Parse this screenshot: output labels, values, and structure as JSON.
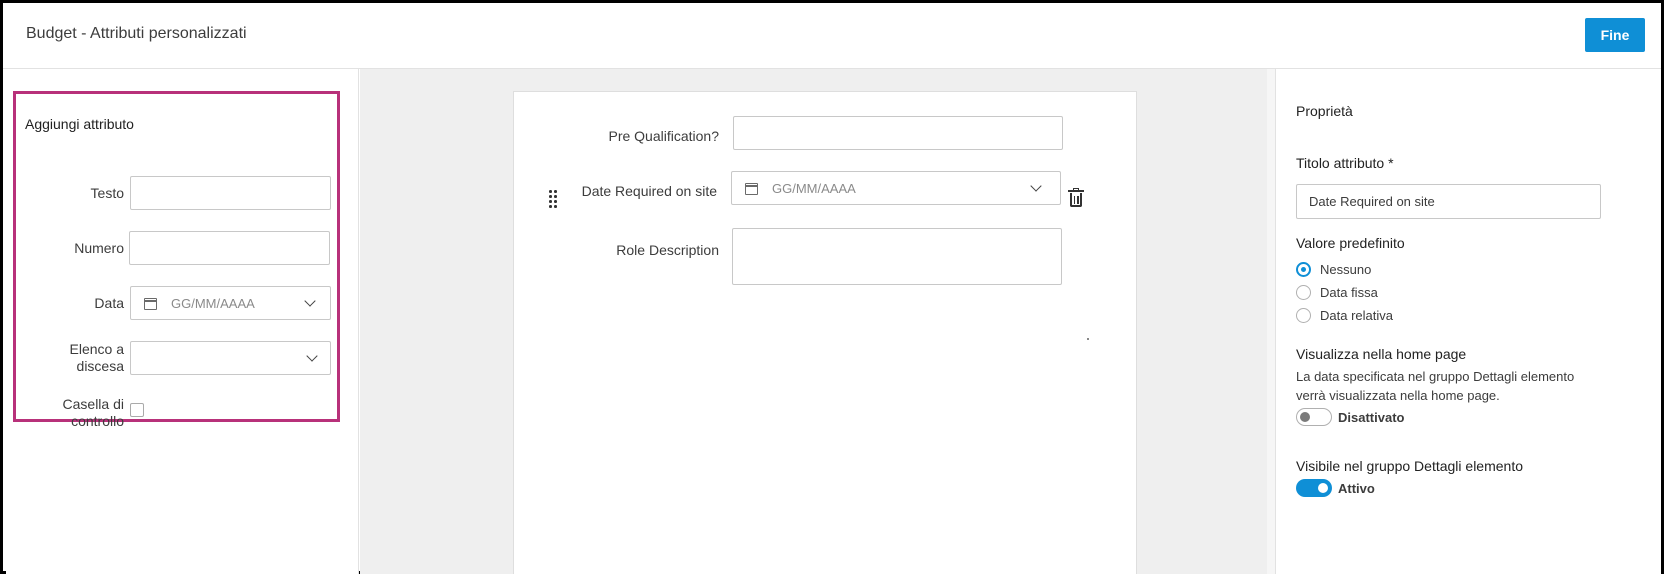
{
  "header": {
    "title": "Budget - Attributi personalizzati",
    "done_label": "Fine"
  },
  "add_panel": {
    "title": "Aggiungi attributo",
    "text_label": "Testo",
    "number_label": "Numero",
    "date_label": "Data",
    "date_placeholder": "GG/MM/AAAA",
    "dropdown_label_line1": "Elenco a",
    "dropdown_label_line2": "discesa",
    "checkbox_label_line1": "Casella di",
    "checkbox_label_line2": "controllo"
  },
  "form": {
    "pre_qualification_label": "Pre Qualification?",
    "date_required_label": "Date Required on site",
    "date_required_placeholder": "GG/MM/AAAA",
    "role_description_label": "Role Description"
  },
  "properties": {
    "title": "Proprietà",
    "attr_title_label": "Titolo attributo *",
    "attr_title_value": "Date Required on site",
    "default_value_label": "Valore predefinito",
    "radio_options": [
      "Nessuno",
      "Data fissa",
      "Data relativa"
    ],
    "selected_option": "Nessuno",
    "home_page_label": "Visualizza nella home page",
    "home_page_desc": "La data specificata nel gruppo Dettagli elemento verrà visualizzata nella home page.",
    "home_page_toggle": "Disattivato",
    "visible_label": "Visibile nel gruppo Dettagli elemento",
    "visible_toggle": "Attivo"
  },
  "colors": {
    "accent": "#0f8fd6",
    "highlight": "#b8317a"
  }
}
